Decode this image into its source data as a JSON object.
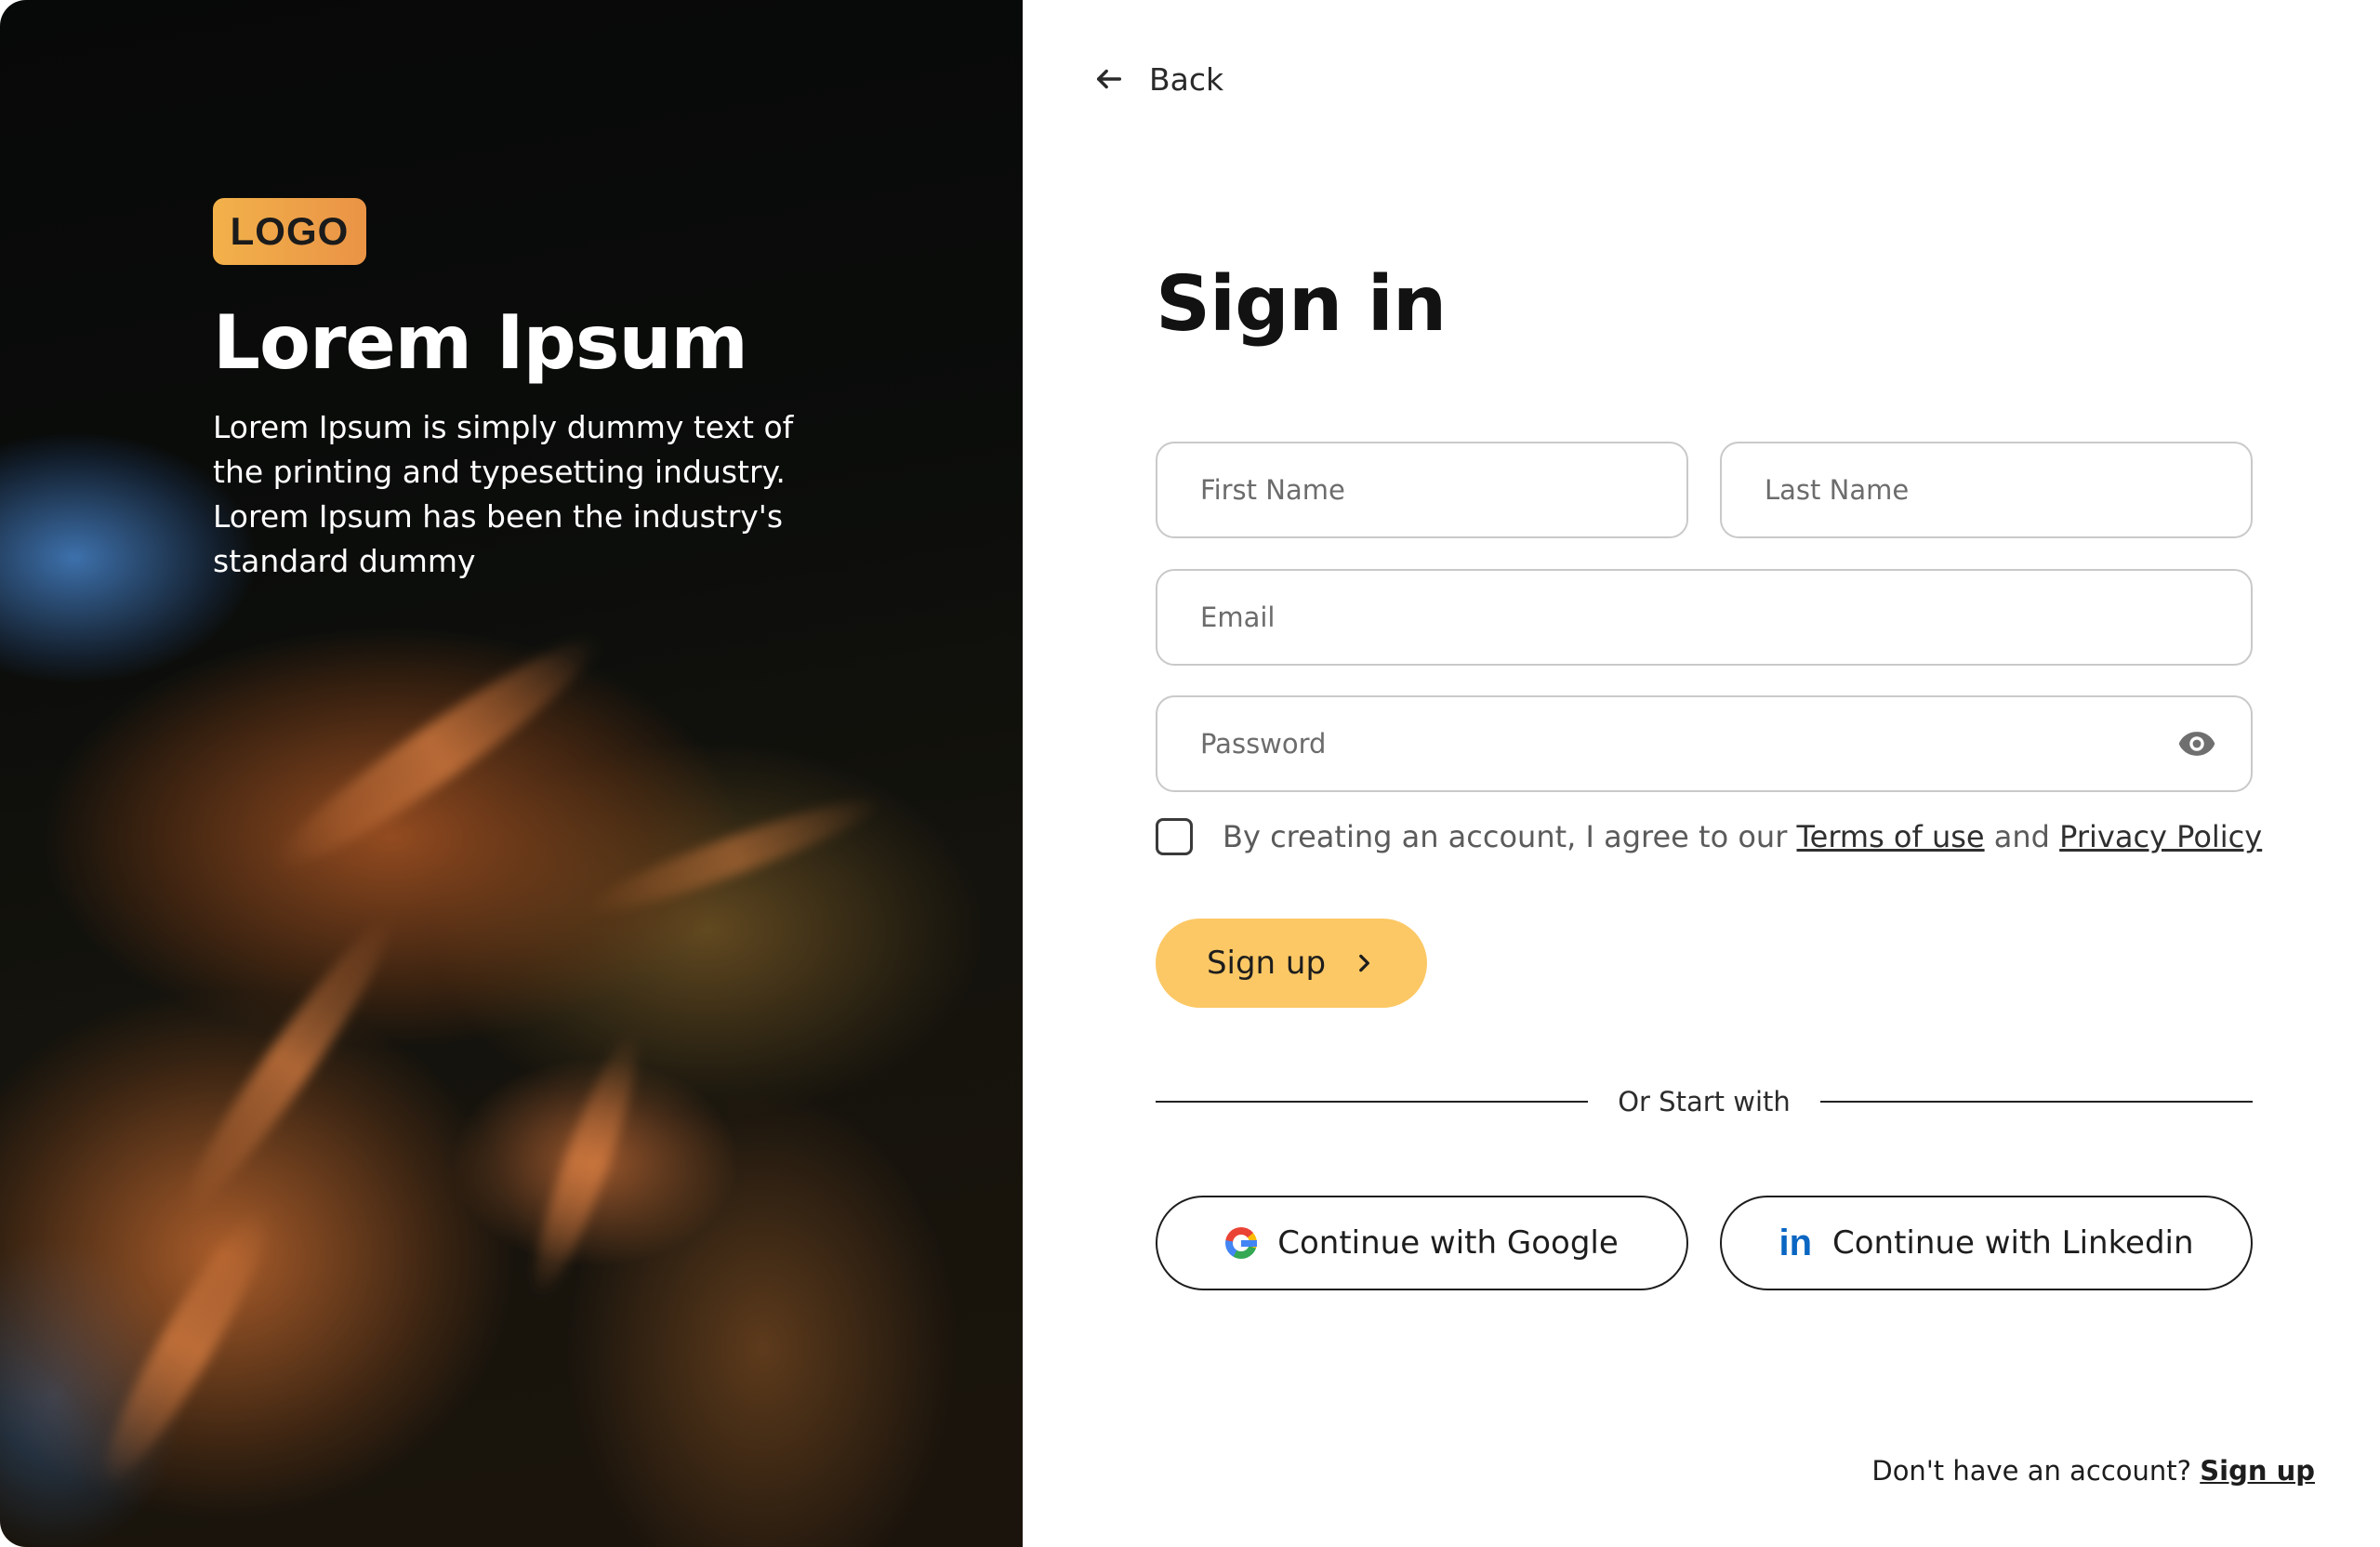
{
  "hero": {
    "logo": "LOGO",
    "title": "Lorem Ipsum",
    "description": "Lorem Ipsum is simply dummy text of the printing and typesetting industry. Lorem Ipsum has been the industry's standard dummy"
  },
  "nav": {
    "back_label": "Back",
    "back_icon": "arrow-left-icon"
  },
  "form": {
    "title": "Sign in",
    "first_name": {
      "placeholder": "First Name",
      "value": ""
    },
    "last_name": {
      "placeholder": "Last Name",
      "value": ""
    },
    "email": {
      "placeholder": "Email",
      "value": ""
    },
    "password": {
      "placeholder": "Password",
      "value": "",
      "toggle_icon": "eye-icon"
    },
    "agreement": {
      "text_before": "By creating an account, I agree to our",
      "terms_link": "Terms of use",
      "text_middle": "and",
      "privacy_link": "Privacy Policy",
      "checked": false
    },
    "submit_label": "Sign up",
    "submit_icon": "chevron-right-icon"
  },
  "social": {
    "divider_label": "Or Start with",
    "google_label": "Continue with Google",
    "google_icon": "google-icon",
    "linkedin_label": "Continue with Linkedin",
    "linkedin_icon": "linkedin-icon",
    "linkedin_glyph": "in"
  },
  "footer": {
    "prompt": "Don't have an account?",
    "link_label": "Sign up"
  },
  "colors": {
    "accent": "#fcc865",
    "logo_gradient_start": "#f2b14a",
    "logo_gradient_end": "#ea9346",
    "linkedin_blue": "#0a66c2"
  }
}
